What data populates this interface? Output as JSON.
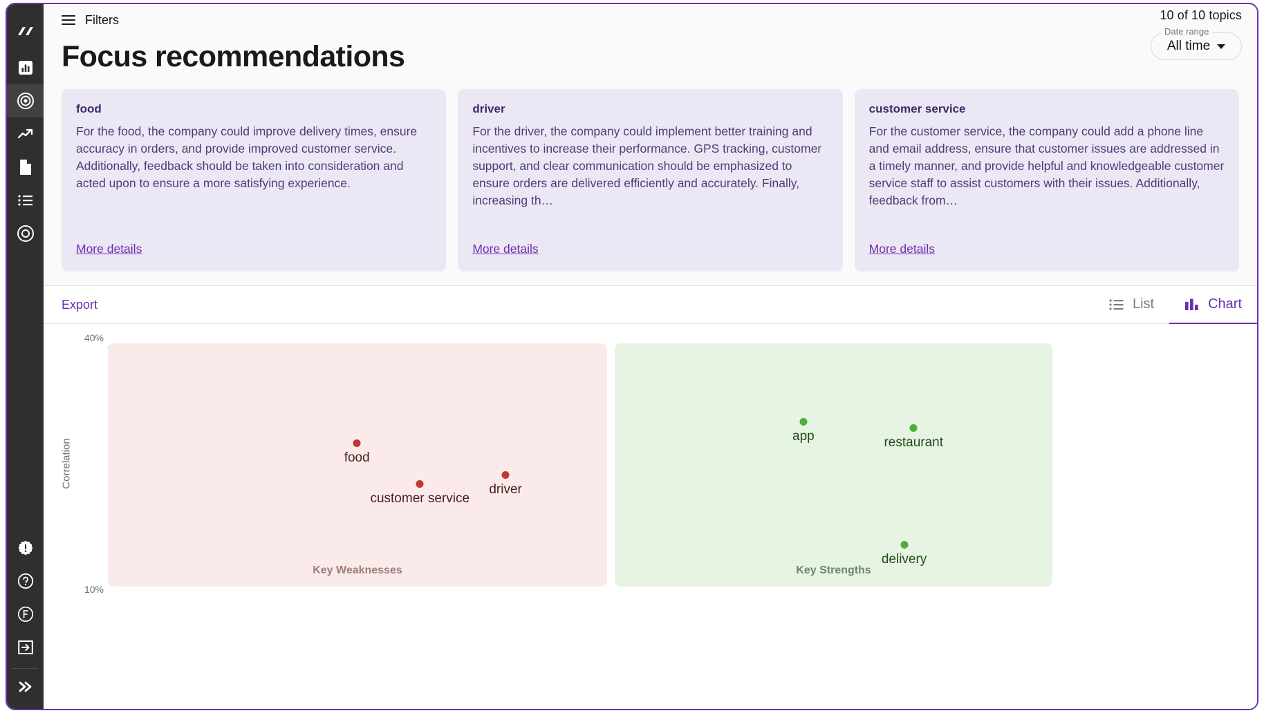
{
  "sidebar": {
    "items": [
      {
        "name": "logo",
        "icon": "logo-icon",
        "active": false
      },
      {
        "name": "dashboard",
        "icon": "bar-chart-icon",
        "active": false
      },
      {
        "name": "focus",
        "icon": "target-icon",
        "active": true
      },
      {
        "name": "trends",
        "icon": "trending-up-icon",
        "active": false
      },
      {
        "name": "documents",
        "icon": "document-icon",
        "active": false
      },
      {
        "name": "list",
        "icon": "list-icon",
        "active": false
      },
      {
        "name": "topics",
        "icon": "circle-target-icon",
        "active": false
      }
    ],
    "bottom_items": [
      {
        "name": "alerts",
        "icon": "alert-badge-icon"
      },
      {
        "name": "help",
        "icon": "question-circle-icon"
      },
      {
        "name": "account",
        "icon": "letter-f-circle-icon"
      },
      {
        "name": "logout",
        "icon": "logout-icon"
      },
      {
        "name": "expand",
        "icon": "double-chevron-right-icon"
      }
    ]
  },
  "topbar": {
    "filters_label": "Filters",
    "topics_count": "10 of 10 topics",
    "date_range_legend": "Date range",
    "date_range_value": "All time"
  },
  "page_title": "Focus recommendations",
  "cards": [
    {
      "title": "food",
      "body": "For the food, the company could improve delivery times, ensure accuracy in orders, and provide improved customer service. Additionally, feedback should be taken into consideration and acted upon to ensure a more satisfying experience.",
      "link": "More details"
    },
    {
      "title": "driver",
      "body": "For the driver, the company could implement better training and incentives to increase their performance. GPS tracking, customer support, and clear communication should be emphasized to ensure orders are delivered efficiently and accurately. Finally, increasing th…",
      "link": "More details"
    },
    {
      "title": "customer service",
      "body": "For the customer service, the company could add a phone line and email address, ensure that customer issues are addressed in a timely manner, and provide helpful and knowledgeable customer service staff to assist customers with their issues. Additionally, feedback from…",
      "link": "More details"
    }
  ],
  "toolbar": {
    "export_label": "Export",
    "tabs": [
      {
        "label": "List",
        "icon": "list-icon",
        "active": false
      },
      {
        "label": "Chart",
        "icon": "bar-chart-icon",
        "active": true
      }
    ]
  },
  "chart_data": {
    "type": "scatter",
    "title": "",
    "xlabel": "",
    "ylabel": "Correlation",
    "ytick_labels": [
      "40%",
      "10%"
    ],
    "ylim": [
      10,
      40
    ],
    "grid": false,
    "legend": false,
    "regions": [
      {
        "label": "Key Weaknesses",
        "color": "#fbeaea",
        "text_color": "#a07b7b"
      },
      {
        "label": "Key Strengths",
        "color": "#e7f3e3",
        "text_color": "#6b8a63"
      }
    ],
    "series": [
      {
        "name": "Key Weaknesses",
        "color": "#c0392b",
        "points": [
          {
            "label": "food",
            "x": 0.395,
            "y": 28.1
          },
          {
            "label": "customer service",
            "x": 0.495,
            "y": 22.9
          },
          {
            "label": "driver",
            "x": 0.631,
            "y": 24.0
          }
        ]
      },
      {
        "name": "Key Strengths",
        "color": "#4caf36",
        "points": [
          {
            "label": "app",
            "x": 1.104,
            "y": 30.8
          },
          {
            "label": "restaurant",
            "x": 1.279,
            "y": 30.0
          },
          {
            "label": "delivery",
            "x": 1.264,
            "y": 15.1
          }
        ]
      }
    ]
  }
}
